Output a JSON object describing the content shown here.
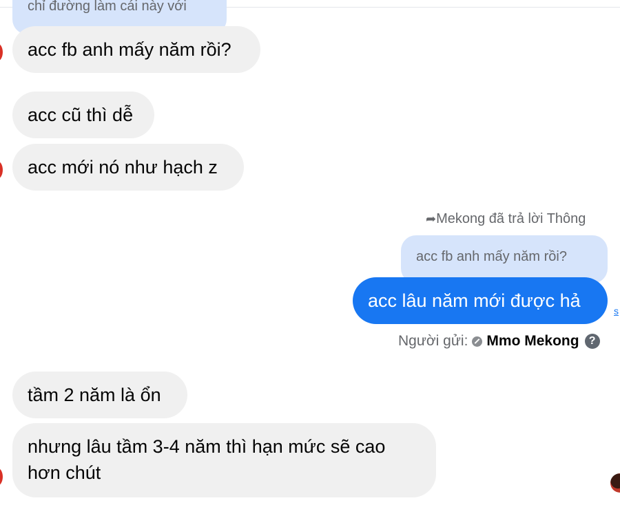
{
  "messages": {
    "quoted_top": "chỉ đường làm cái này với",
    "m1": "acc fb anh mấy năm rồi?",
    "m2": "acc cũ thì dễ",
    "m3": "acc mới nó như hạch z",
    "reply_label": "Mekong đã trả lời Thông",
    "reply_quote": "acc fb anh mấy năm rồi?",
    "out1": "acc lâu năm mới được hả",
    "sender_prefix": "Người gửi:",
    "sender_name": "Mmo Mekong",
    "m4": "tầm 2 năm là ổn",
    "m5_line1": "nhưng lâu tầm 3-4 năm thì hạn mức sẽ cao",
    "m5_line2": "hơn chút"
  },
  "icons": {
    "reply": "reply-arrow-icon",
    "verified": "verified-badge-icon",
    "help": "help-icon"
  },
  "colors": {
    "outgoing": "#1877f2",
    "incoming": "#f0f0f0",
    "quoted": "#d6e4fb"
  }
}
